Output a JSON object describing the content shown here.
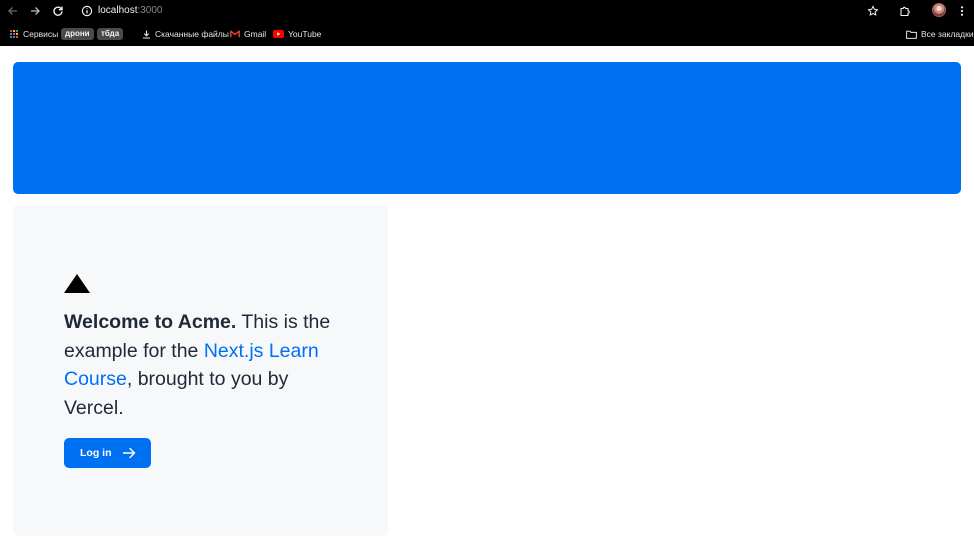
{
  "browser": {
    "url_host": "localhost",
    "url_port": ":3000",
    "bookmarks": {
      "apps_label": "Сервисы",
      "chips": [
        "дрони",
        "тбда"
      ],
      "downloads_label": "Скачанные файлы",
      "gmail_label": "Gmail",
      "youtube_label": "YouTube",
      "all_bookmarks_label": "Все закладки"
    }
  },
  "page": {
    "intro": {
      "bold": "Welcome to Acme.",
      "text_1": " This is the example for the ",
      "link": "Next.js Learn Course",
      "text_2": ", brought to you by Vercel."
    },
    "login_label": "Log in"
  },
  "colors": {
    "brand_blue": "#0070f3",
    "panel_bg": "#f7f8fa",
    "text": "#1f2937"
  }
}
